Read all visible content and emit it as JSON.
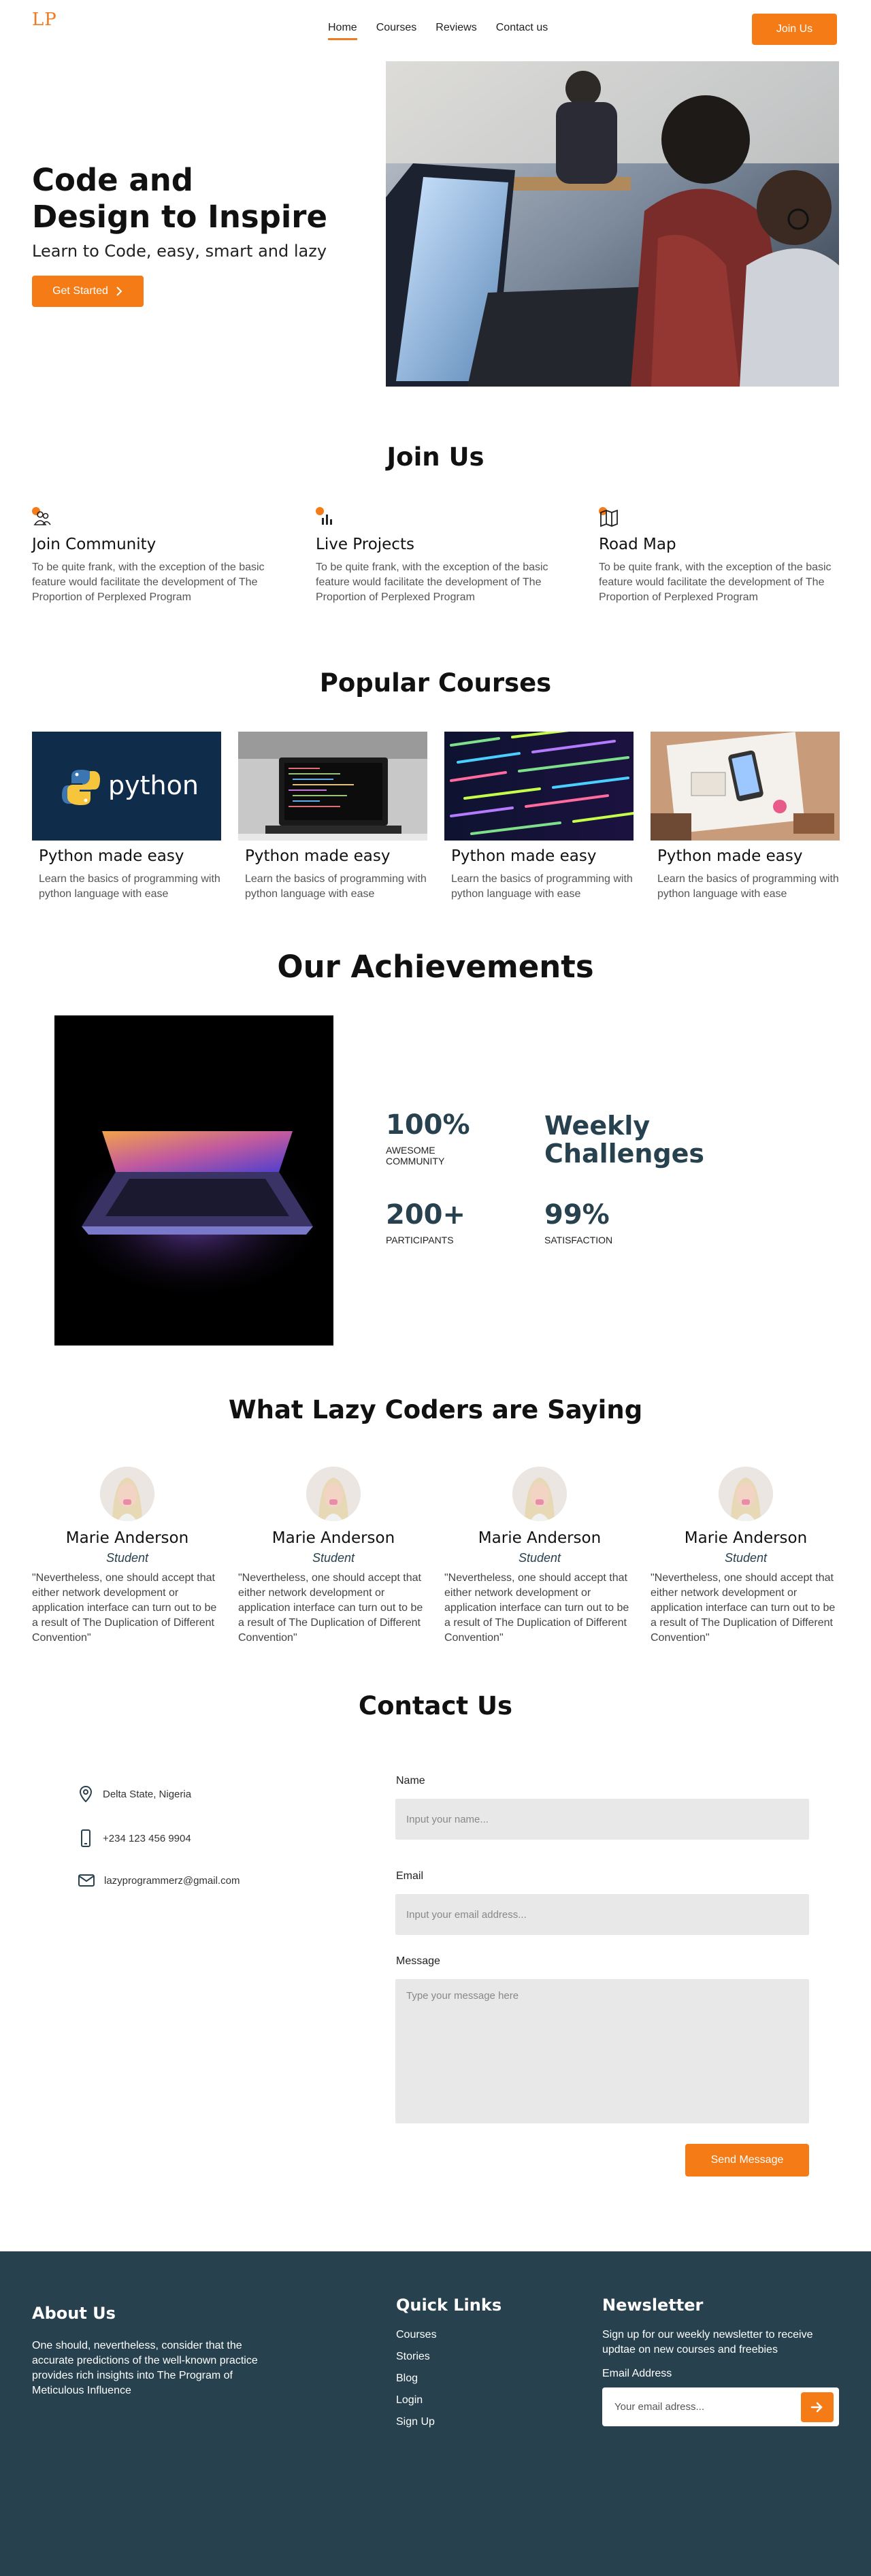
{
  "nav": {
    "logo": "LP",
    "links": [
      "Home",
      "Courses",
      "Reviews",
      "Contact us"
    ],
    "join_label": "Join Us"
  },
  "hero": {
    "title_line1": "Code and",
    "title_line2": "Design to Inspire",
    "subtitle": "Learn to Code, easy, smart and lazy",
    "cta_label": "Get Started"
  },
  "join": {
    "heading": "Join Us",
    "features": [
      {
        "icon": "community-icon",
        "title": "Join Community",
        "text": "To be quite frank, with the exception of the basic feature would facilitate the development of The Proportion of Perplexed Program"
      },
      {
        "icon": "chart-icon",
        "title": "Live Projects",
        "text": "To be quite frank, with the exception of the basic feature would facilitate the development of The Proportion of Perplexed Program"
      },
      {
        "icon": "map-icon",
        "title": "Road Map",
        "text": "To be quite frank, with the exception of the basic feature would facilitate the development of The Proportion of Perplexed Program"
      }
    ]
  },
  "courses": {
    "heading": "Popular Courses",
    "python_logo_text": "python",
    "items": [
      {
        "title": "Python made easy",
        "text": "Learn the basics of programming with python language with ease"
      },
      {
        "title": "Python made easy",
        "text": "Learn the basics of programming with python language with ease"
      },
      {
        "title": "Python made easy",
        "text": "Learn the basics of programming with python language with ease"
      },
      {
        "title": "Python made easy",
        "text": "Learn the basics of programming with python language with ease"
      }
    ]
  },
  "achievements": {
    "heading": "Our Achievements",
    "stats": [
      {
        "value": "100%",
        "label_line1": "AWESOME",
        "label_line2": "COMMUNITY"
      },
      {
        "value_line1": "Weekly",
        "value_line2": "Challenges"
      },
      {
        "value": "200+",
        "label": "PARTICIPANTS"
      },
      {
        "value": "99%",
        "label": "SATISFACTION"
      }
    ]
  },
  "testimonials": {
    "heading": "What Lazy Coders are Saying",
    "items": [
      {
        "name": "Marie Anderson",
        "role": "Student",
        "quote": "\"Nevertheless, one should accept that either network development or application interface can turn out to be a result of The Duplication of Different Convention\""
      },
      {
        "name": "Marie Anderson",
        "role": "Student",
        "quote": "\"Nevertheless, one should accept that either network development or application interface can turn out to be a result of The Duplication of Different Convention\""
      },
      {
        "name": "Marie Anderson",
        "role": "Student",
        "quote": "\"Nevertheless, one should accept that either network development or application interface can turn out to be a result of The Duplication of Different Convention\""
      },
      {
        "name": "Marie Anderson",
        "role": "Student",
        "quote": "\"Nevertheless, one should accept that either network development or application interface can turn out to be a result of The Duplication of Different Convention\""
      }
    ]
  },
  "contact": {
    "heading": "Contact Us",
    "location": "Delta State, Nigeria",
    "phone": "+234 123 456 9904",
    "email": "lazyprogrammerz@gmail.com",
    "form": {
      "name_label": "Name",
      "name_placeholder": "Input your name...",
      "email_label": "Email",
      "email_placeholder": "Input your email address...",
      "message_label": "Message",
      "message_placeholder": "Type your message here",
      "send_label": "Send Message"
    }
  },
  "footer": {
    "about_heading": "About Us",
    "about_text": "One should, nevertheless, consider that the accurate predictions of the well-known practice provides rich insights into The Program of Meticulous Influence",
    "links_heading": "Quick Links",
    "links": [
      "Courses",
      "Stories",
      "Blog",
      "Login",
      "Sign Up"
    ],
    "newsletter_heading": "Newsletter",
    "newsletter_text": "Sign up for our weekly newsletter to receive updtae on new courses and freebies",
    "email_label": "Email Address",
    "email_placeholder": "Your email adress..."
  },
  "colors": {
    "accent": "#f47b16",
    "dark": "#27414f"
  }
}
